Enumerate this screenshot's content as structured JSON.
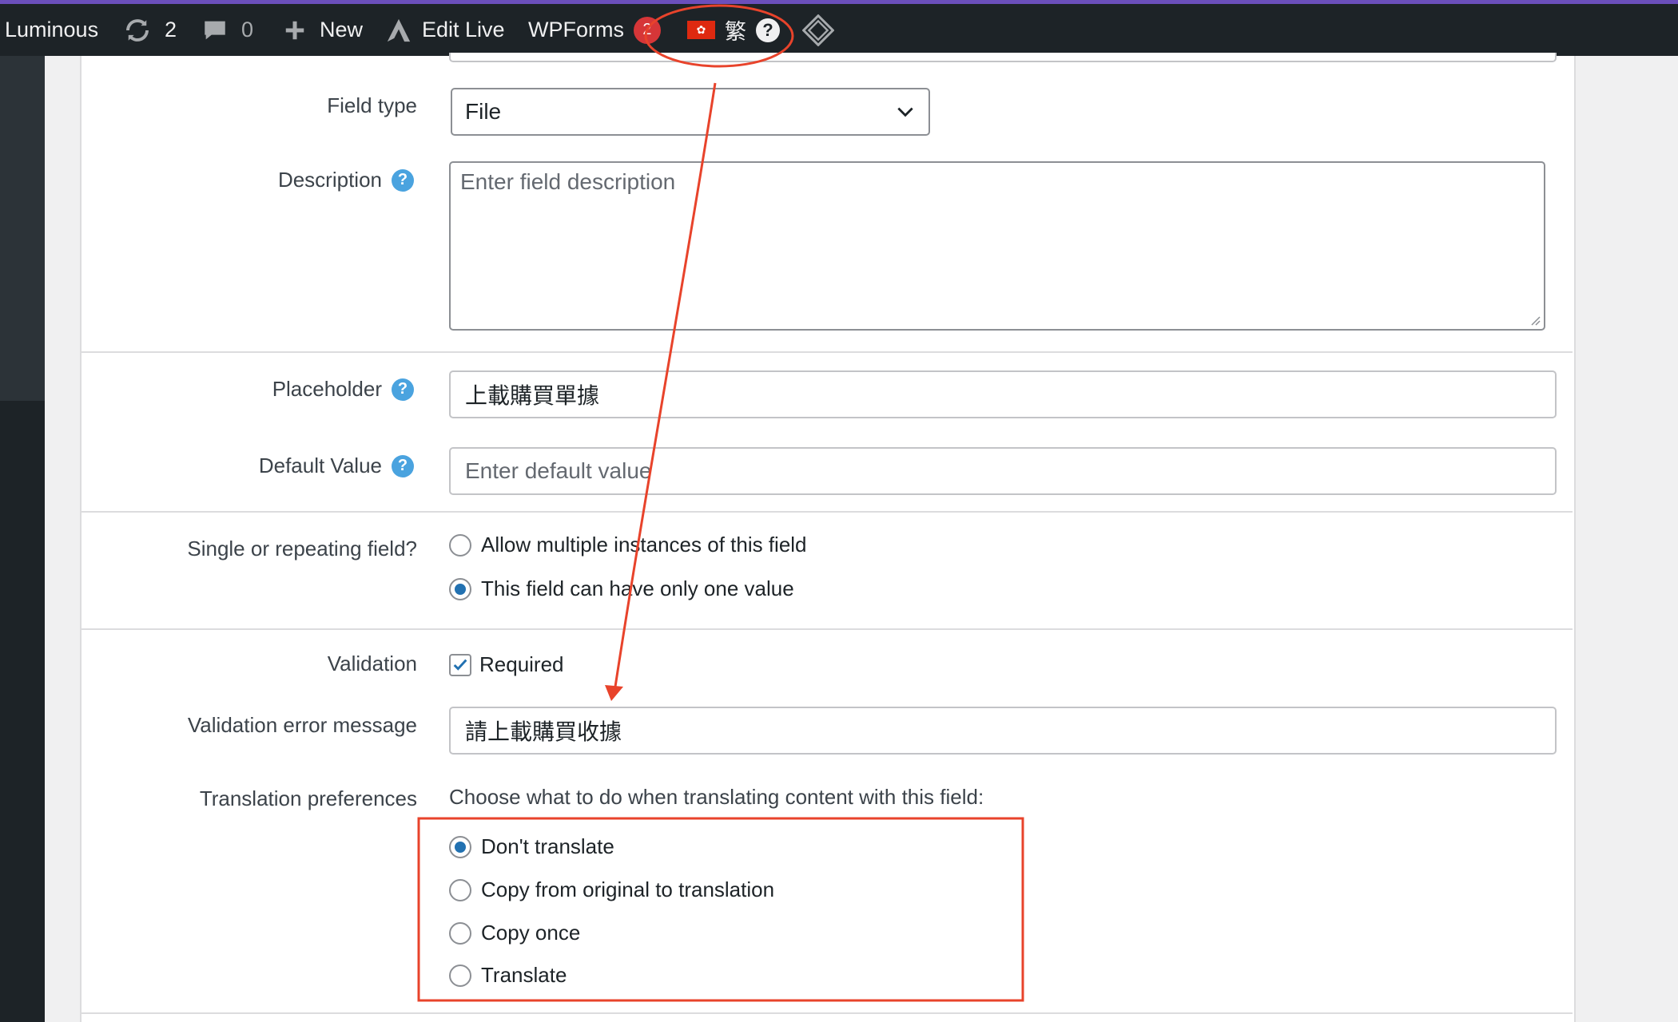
{
  "adminbar": {
    "site_name": "Luminous",
    "updates_count": "2",
    "comments_count": "0",
    "new_label": "New",
    "edit_live_label": "Edit Live",
    "wpforms_label": "WPForms",
    "wpforms_badge": "2",
    "language_label": "繁",
    "help_label": "?"
  },
  "form": {
    "field_type": {
      "label": "Field type",
      "value": "File"
    },
    "description": {
      "label": "Description",
      "placeholder": "Enter field description"
    },
    "placeholder": {
      "label": "Placeholder",
      "value": "上載購買單據"
    },
    "default_value": {
      "label": "Default Value",
      "placeholder": "Enter default value"
    },
    "repeat": {
      "label": "Single or repeating field?",
      "options": [
        "Allow multiple instances of this field",
        "This field can have only one value"
      ],
      "selected": 1
    },
    "validation": {
      "label": "Validation",
      "required_label": "Required",
      "required_checked": true
    },
    "validation_error": {
      "label": "Validation error message",
      "value": "請上載購買收據"
    },
    "translation": {
      "label": "Translation preferences",
      "note": "Choose what to do when translating content with this field:",
      "options": [
        "Don't translate",
        "Copy from original to translation",
        "Copy once",
        "Translate"
      ],
      "selected": 0
    }
  },
  "colors": {
    "adminbar_bg": "#1d2327",
    "accent_top": "#6b4fbb",
    "annotation_red": "#e8432b",
    "radio_selected": "#2271b1",
    "help_icon": "#4aa3df",
    "badge_red": "#d63638"
  }
}
